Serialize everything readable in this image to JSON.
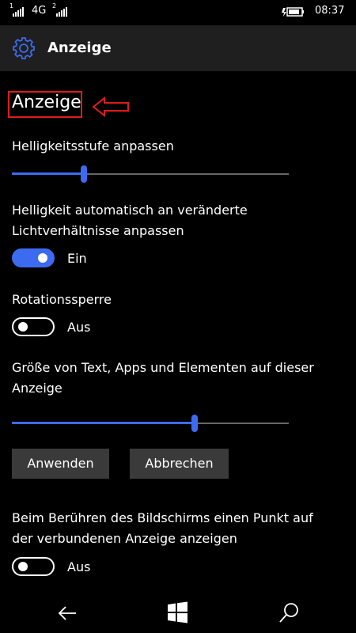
{
  "statusbar": {
    "sim1_num": "1",
    "sim1_network": "4G",
    "sim2_num": "2",
    "time": "08:37"
  },
  "titlebar": {
    "title": "Anzeige",
    "icon": "gear-icon"
  },
  "page": {
    "heading": "Anzeige",
    "brightness_label": "Helligkeitsstufe anpassen",
    "brightness_value_percent": 26,
    "auto_brightness_label_line1": "Helligkeit automatisch an veränderte",
    "auto_brightness_label_line2": "Lichtverhältnisse anpassen",
    "auto_brightness_state": "Ein",
    "rotation_label": "Rotationssperre",
    "rotation_state": "Aus",
    "size_label_line1": "Größe von Text, Apps und Elementen auf dieser",
    "size_label_line2": "Anzeige",
    "size_value_percent": 66,
    "apply_button": "Anwenden",
    "cancel_button": "Abbrechen",
    "touch_label_line1": "Beim Berühren des Bildschirms einen Punkt auf",
    "touch_label_line2": "der verbundenen Anzeige anzeigen",
    "touch_state": "Aus"
  },
  "colors": {
    "accent": "#3c6bf0",
    "annotation": "#e01b1b",
    "titlebar_bg": "#1f1f1f",
    "button_bg": "#3a3a3a"
  },
  "navbar": {
    "back": "back-arrow-icon",
    "start": "windows-start-icon",
    "search": "search-icon"
  }
}
